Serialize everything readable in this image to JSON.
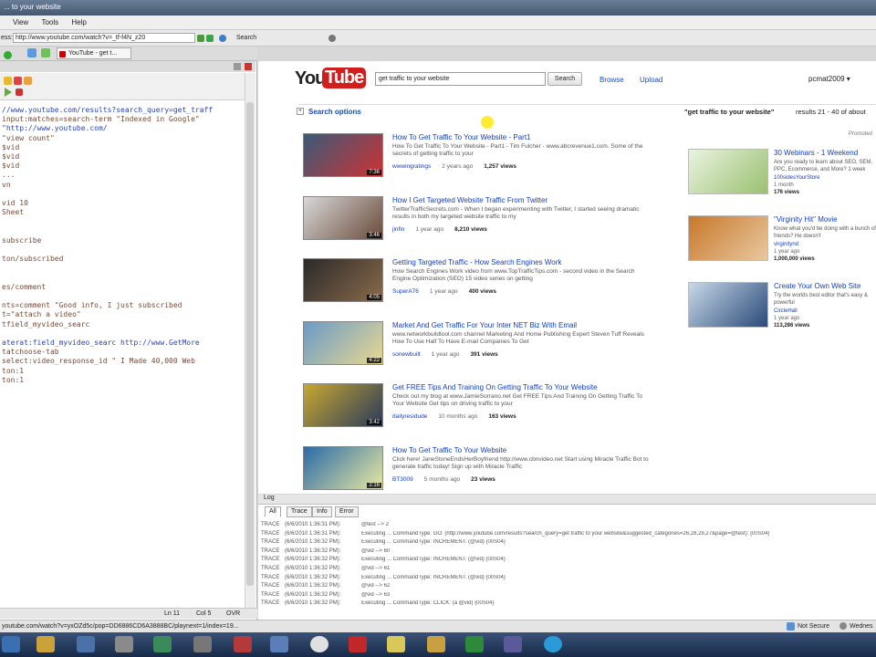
{
  "window": {
    "title": "... to your website"
  },
  "menu": [
    "View",
    "Tools",
    "Help"
  ],
  "navbar": {
    "address_label": "ess:",
    "address": "http://www.youtube.com/watch?v=_tf-f4N_z20",
    "search_label": "Search"
  },
  "tab": {
    "label": "YouTube - get t..."
  },
  "left": {
    "code_lines": [
      "//www.youtube.com/results?search_query=get_traff",
      "input:matches=search-term  \"Indexed in Google\"",
      "  \"http://www.youtube.com/",
      "\"view count\"",
      "  $vid",
      "  $vid",
      "  $vid",
      "  ...",
      "  vn",
      "",
      "vid 10",
      "  Sheet",
      "",
      "",
      "subscribe",
      "",
      "ton/subscribed",
      "",
      "",
      "es/comment",
      "",
      "nts=comment    \"Good info, I just subscribed",
      "t=\"attach a video\"",
      "tfield_myvideo_searc",
      "",
      "aterat:field_myvideo_searc   http://www.GetMore",
      "tatchoose-tab",
      "select:video_response_id    \" I Made 40,000 Web",
      "ton:1",
      "ton:1"
    ],
    "status": [
      "Ln 11",
      "Col 5",
      "OVR"
    ]
  },
  "youtube": {
    "logo_you": "You",
    "logo_tube": "Tube",
    "search_value": "get traffic to your website",
    "search_button": "Search",
    "browse": "Browse",
    "upload": "Upload",
    "user": "pcmat2009 ▾",
    "search_options": "Search options",
    "results_summary_query": "\"get traffic to your website\"",
    "results_summary_rest": "results 21 - 40 of about",
    "promoted": "Promoted",
    "results": [
      {
        "title": "How To Get Traffic To Your Website - Part1",
        "desc": "How To Get Traffic To Your Website - Part1 - Tim Fulcher - www.abcrevenue1.com. Some of the secrets of getting traffic to your",
        "by": "wwwingratings",
        "age": "2 years ago",
        "views": "1,257 views",
        "duration": "7:36"
      },
      {
        "title": "How I Get Targeted Website Traffic From Twitter",
        "desc": "TwitterTrafficSecrets.com - When I began experimenting with Twitter, I started seeing dramatic results in both my targeted website traffic to my",
        "by": "jinfin",
        "age": "1 year ago",
        "views": "8,210 views",
        "duration": "3:46"
      },
      {
        "title": "Getting Targeted Traffic - How Search Engines Work",
        "desc": "How Search Engines Work video from www.TopTrafficTips.com - second video in the Search Engine Optimization (SEO) 15 video series on getting",
        "by": "SuperA76",
        "age": "1 year ago",
        "views": "400 views",
        "duration": "4:05"
      },
      {
        "title": "Market And Get Traffic For Your Inter NET Biz With Email",
        "desc": "www.networkbuildtool.com channel Marketing And Home Publishing Expert Steven Tuff Reveals How To Use Half To Have E-mail Companies To Get",
        "by": "sonewbuilt",
        "age": "1 year ago",
        "views": "391 views",
        "duration": "4:22"
      },
      {
        "title": "Get FREE Tips And Training On Getting Traffic To Your Website",
        "desc": "Check out my blog at www.JamieSorrano.net Get FREE Tips And Training On Getting Traffic To Your Website Get tips on driving traffic to your",
        "by": "dailyresidude",
        "age": "10 months ago",
        "views": "163 views",
        "duration": "3:42"
      },
      {
        "title": "How To Get Traffic To Your Website",
        "desc": "Click here! JaneStoneEndsHerBoyfriend http://www.cbnvideo.net Start using Miracle Traffic Bot to generate traffic today! Sign up with Miracle Traffic",
        "by": "BT3009",
        "age": "5 months ago",
        "views": "23 views",
        "duration": "2:16"
      }
    ],
    "sidebar": [
      {
        "title": "30 Webinars - 1 Weekend",
        "desc": "Are you ready to learn about SEO, SEM, PPC, Ecommerce, and More? 1 week",
        "by": "100sidesYourStore",
        "age": "1 month",
        "views": "176 views"
      },
      {
        "title": "\"Virginity Hit\" Movie",
        "desc": "Know what you'd be doing with a bunch of friends? He doesn't",
        "by": "virginitynd",
        "age": "1 year ago",
        "views": "1,000,000 views"
      },
      {
        "title": "Create Your Own Web Site",
        "desc": "Try the worlds best editor that's easy & powerful",
        "by": "CircleHall",
        "age": "1 year ago",
        "views": "113,286 views"
      }
    ]
  },
  "log": {
    "header": "Log",
    "tabs": [
      "All",
      "Trace",
      "Info",
      "Error"
    ],
    "lines": [
      {
        "level": "TRACE",
        "time": "(6/6/2010 1:36:31 PM):",
        "msg": "@test --> 2"
      },
      {
        "level": "TRACE",
        "time": "(6/6/2010 1:36:31 PM):",
        "msg": "Executing ... CommandType: GO: (http://www.youtube.com/results?search_query=get traffic to your website&suggested_categories=26,28,29,27&page=@test): {00S04}"
      },
      {
        "level": "TRACE",
        "time": "(6/6/2010 1:36:32 PM):",
        "msg": "Executing ... CommandType: INCREMENT: (@vid) {00S04}"
      },
      {
        "level": "TRACE",
        "time": "(6/6/2010 1:36:32 PM):",
        "msg": "@vid --> 60"
      },
      {
        "level": "TRACE",
        "time": "(6/6/2010 1:36:32 PM):",
        "msg": "Executing ... CommandType: INCREMENT: (@vid) {00S04}"
      },
      {
        "level": "TRACE",
        "time": "(6/6/2010 1:36:32 PM):",
        "msg": "@vid --> 61"
      },
      {
        "level": "TRACE",
        "time": "(6/6/2010 1:36:32 PM):",
        "msg": "Executing ... CommandType: INCREMENT: (@vid) {00S04}"
      },
      {
        "level": "TRACE",
        "time": "(6/6/2010 1:36:32 PM):",
        "msg": "@vid --> 62"
      },
      {
        "level": "TRACE",
        "time": "(6/6/2010 1:36:32 PM):",
        "msg": "@vid --> 63"
      },
      {
        "level": "TRACE",
        "time": "(6/6/2010 1:36:32 PM):",
        "msg": "Executing ... CommandType: CLICK: (a @vid) {00S04}"
      }
    ]
  },
  "status": {
    "url": "youtube.com/watch?v=yxOZd5c/pop=DD6886CD6A3888BC/playnext=1/index=19...",
    "security": "Not Secure",
    "day": "Wednes"
  }
}
